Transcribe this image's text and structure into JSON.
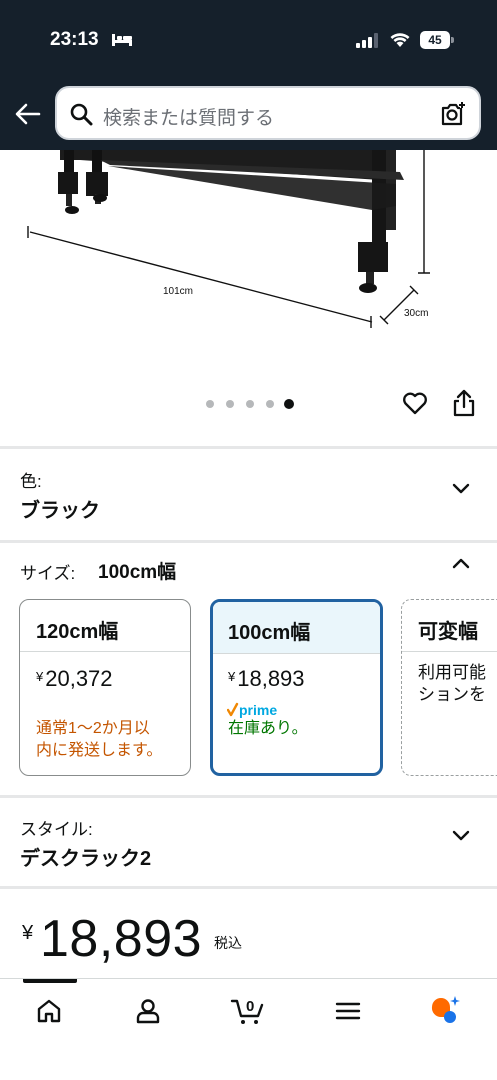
{
  "status_bar": {
    "time": "23:13",
    "battery": "45"
  },
  "search": {
    "placeholder": "検索または質問する"
  },
  "product_image": {
    "width_label": "101cm",
    "depth_label": "30cm",
    "carousel": {
      "total": 5,
      "active_index": 4
    }
  },
  "color_option": {
    "label": "色:",
    "value": "ブラック"
  },
  "size_option": {
    "label": "サイズ:",
    "value": "100cm幅",
    "cards": [
      {
        "title": "120cm幅",
        "yen": "¥",
        "price": "20,372",
        "note": "通常1～2か月以内に発送します。",
        "note_line1": "通常1～2か月以",
        "note_line2": "内に発送します。",
        "note_color": "#c45500"
      },
      {
        "title": "100cm幅",
        "yen": "¥",
        "price": "18,893",
        "prime": "prime",
        "note": "在庫あり。",
        "note_color": "#007600"
      },
      {
        "title": "可変幅",
        "note_line1": "利用可能",
        "note_line2": "ションを"
      }
    ]
  },
  "style_option": {
    "label": "スタイル:",
    "value": "デスクラック2"
  },
  "price": {
    "yen": "¥",
    "amount": "18,893",
    "tax": "税込"
  },
  "bottom_nav": {
    "items": [
      "home-icon",
      "account-icon",
      "cart-icon",
      "menu-icon",
      "rufus-icon"
    ],
    "cart_count": "0"
  },
  "colors": {
    "header_bg": "#15202b",
    "selected_border": "#2162a1",
    "shipping_note": "#c45500",
    "in_stock": "#007600",
    "prime_check": "#f08804",
    "prime_text": "#00a8e1",
    "rufus_orange": "#ff6a00",
    "rufus_blue": "#1a73e8"
  }
}
